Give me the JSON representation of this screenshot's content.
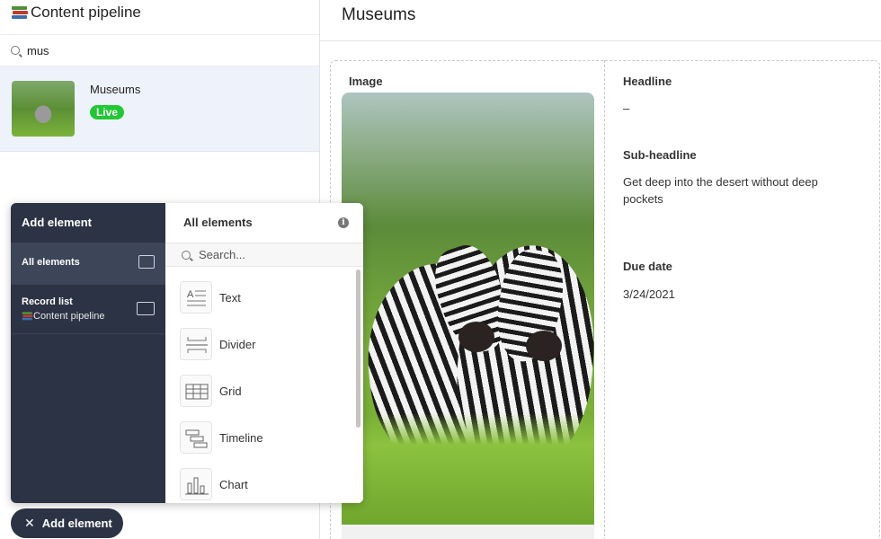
{
  "app": {
    "title": "Content pipeline",
    "icon": "books-icon"
  },
  "search": {
    "value": "mus"
  },
  "records": [
    {
      "name": "Museums",
      "status": "Live",
      "status_color": "#20c933"
    }
  ],
  "detail": {
    "title": "Museums",
    "image_label": "Image",
    "headline_label": "Headline",
    "headline_value": "–",
    "subheadline_label": "Sub-headline",
    "subheadline_value": "Get deep into the desert without deep pockets",
    "due_label": "Due date",
    "due_value": "3/24/2021"
  },
  "add_panel": {
    "title": "Add element",
    "nav": [
      {
        "label": "All elements"
      },
      {
        "label": "Record list",
        "sub": "Content pipeline"
      }
    ],
    "list_title": "All elements",
    "search_placeholder": "Search...",
    "elements": [
      {
        "label": "Text",
        "icon": "text-icon"
      },
      {
        "label": "Divider",
        "icon": "divider-icon"
      },
      {
        "label": "Grid",
        "icon": "grid-icon"
      },
      {
        "label": "Timeline",
        "icon": "timeline-icon"
      },
      {
        "label": "Chart",
        "icon": "chart-icon"
      }
    ]
  },
  "add_button": {
    "label": "Add element",
    "icon": "close-icon"
  },
  "colors": {
    "sidebar_dark": "#2c3344",
    "selection": "#eef2fb",
    "live_green": "#20c933"
  }
}
